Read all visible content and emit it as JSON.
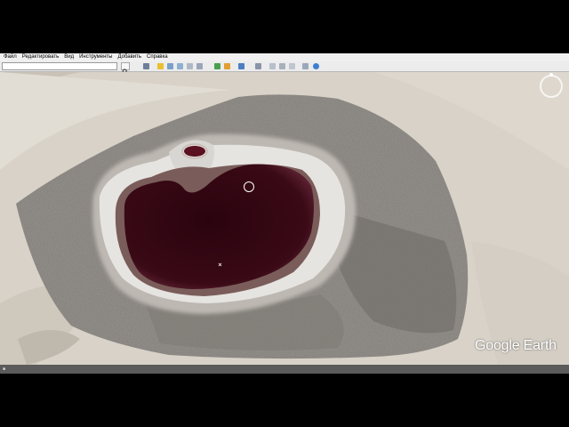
{
  "menu": {
    "items": [
      "Файл",
      "Редактировать",
      "Вид",
      "Инструменты",
      "Добавить",
      "Справка"
    ]
  },
  "toolbar": {
    "icons": [
      "sidebar-icon",
      "placemark-icon",
      "polygon-icon",
      "path-icon",
      "image-overlay-icon",
      "record-tour-icon",
      "historical-imagery-icon",
      "sun-icon",
      "planets-icon",
      "ruler-icon",
      "email-icon",
      "print-icon",
      "save-image-icon",
      "maps-icon"
    ]
  },
  "brand": {
    "logo": "Google Earth"
  },
  "colors": {
    "lake": "#2e0610",
    "sand": "#d6d0c6",
    "crust": "#8e8a84",
    "status_bg": "#5b5b5b"
  }
}
